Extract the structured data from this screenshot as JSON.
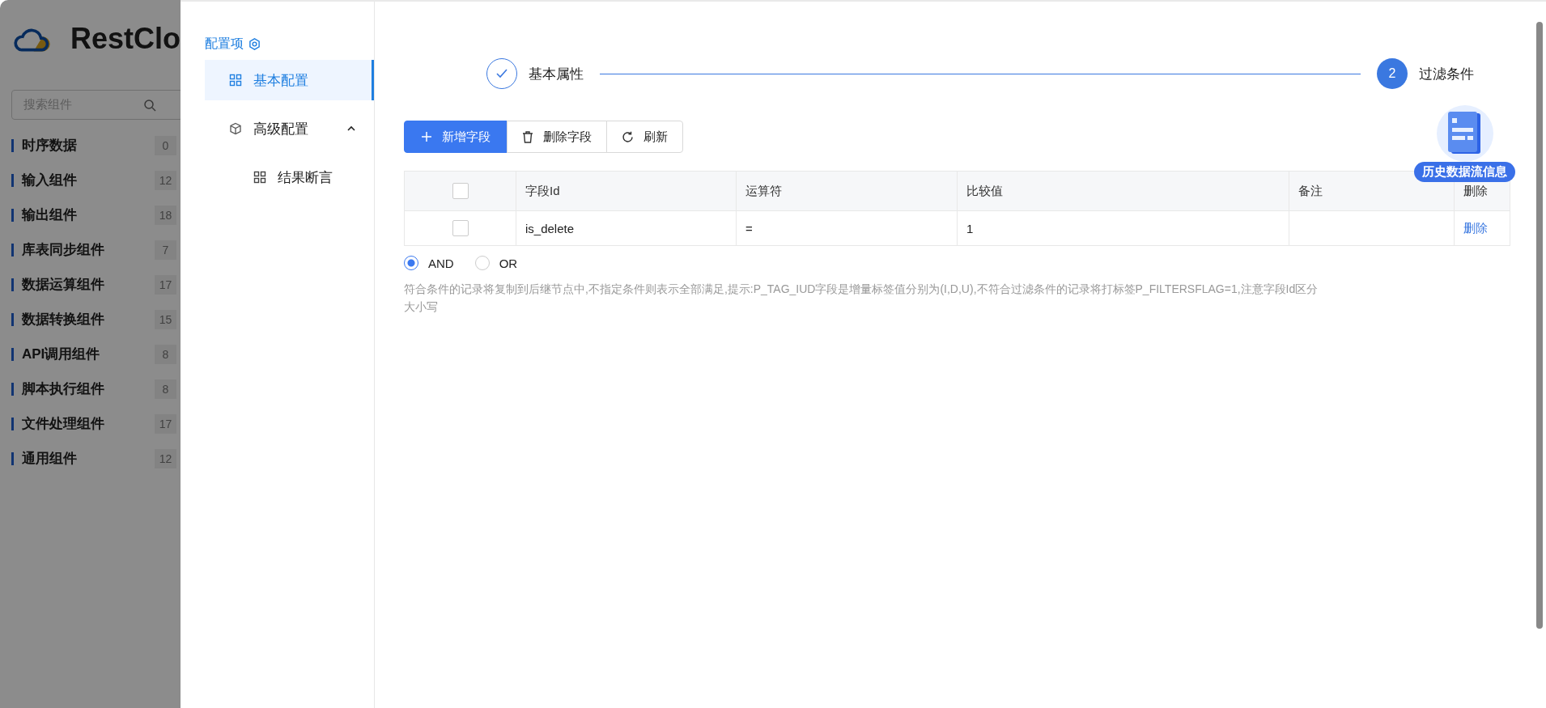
{
  "background_app": {
    "logo": "RestClo",
    "search": {
      "placeholder": "搜索组件"
    },
    "categories": [
      {
        "name": "时序数据",
        "count": "0"
      },
      {
        "name": "输入组件",
        "count": "12"
      },
      {
        "name": "输出组件",
        "count": "18"
      },
      {
        "name": "库表同步组件",
        "count": "7"
      },
      {
        "name": "数据运算组件",
        "count": "17"
      },
      {
        "name": "数据转换组件",
        "count": "15"
      },
      {
        "name": "API调用组件",
        "count": "8"
      },
      {
        "name": "脚本执行组件",
        "count": "8"
      },
      {
        "name": "文件处理组件",
        "count": "17"
      },
      {
        "name": "通用组件",
        "count": "12"
      }
    ]
  },
  "drawer": {
    "menu_title": "配置项",
    "menu": [
      {
        "label": "基本配置",
        "selected": true
      },
      {
        "label": "高级配置",
        "selected": false,
        "expanded": true,
        "children": [
          {
            "label": "结果断言",
            "selected": false
          }
        ]
      }
    ],
    "steps": [
      {
        "label": "基本属性",
        "done": true
      },
      {
        "label": "过滤条件",
        "number": "2",
        "done": false
      }
    ],
    "toolbar": [
      {
        "label": "新增字段",
        "kind": "add"
      },
      {
        "label": "删除字段",
        "kind": "delete"
      },
      {
        "label": "刷新",
        "kind": "refresh"
      }
    ],
    "table": {
      "select_all": {
        "checked": false
      },
      "columns": [
        "字段Id",
        "运算符",
        "比较值",
        "备注",
        "删除"
      ],
      "rows": [
        {
          "checked": false,
          "field_id": "is_delete",
          "operator": "=",
          "compare_value": "1",
          "action": "删除"
        }
      ]
    },
    "logic": [
      {
        "label": "AND",
        "selected": true
      },
      {
        "label": "OR",
        "selected": false
      }
    ],
    "help_text": "符合条件的记录将复制到后继节点中,不指定条件则表示全部满足,提示:P_TAG_IUD字段是增量标签值分别为(I,D,U),不符合过滤条件的记录将打标签P_FILTERSFLAG=1,注意字段Id区分大小写",
    "floating_badge": "历史数据流信息"
  }
}
